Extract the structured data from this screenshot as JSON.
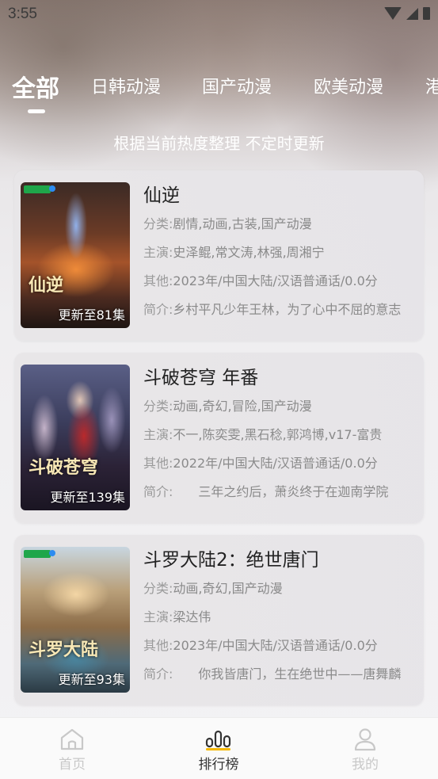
{
  "status_bar": {
    "time": "3:55"
  },
  "tabs": [
    "全部",
    "日韩动漫",
    "国产动漫",
    "欧美动漫",
    "港"
  ],
  "active_tab": 0,
  "subtitle": "根据当前热度整理 不定时更新",
  "labels": {
    "category": "分类:",
    "cast": "主演:",
    "other": "其他:",
    "intro": "简介:"
  },
  "items": [
    {
      "title": "仙逆",
      "episode": "更新至81集",
      "poster_text": "仙逆",
      "category": "剧情,动画,古装,国产动漫",
      "cast": "史泽鲲,常文涛,林强,周湘宁",
      "other": "2023年/中国大陆/汉语普通话/0.0分",
      "intro": "乡村平凡少年王林，为了心中不屈的意志"
    },
    {
      "title": "斗破苍穹 年番",
      "episode": "更新至139集",
      "poster_text": "斗破苍穹",
      "category": "动画,奇幻,冒险,国产动漫",
      "cast": "不一,陈奕雯,黑石稔,郭鸿博,v17-富贵",
      "other": "2022年/中国大陆/汉语普通话/0.0分",
      "intro": "　　三年之约后，萧炎终于在迦南学院"
    },
    {
      "title": "斗罗大陆2：绝世唐门",
      "episode": "更新至93集",
      "poster_text": "斗罗大陆",
      "category": "动画,奇幻,国产动漫",
      "cast": "梁达伟",
      "other": "2023年/中国大陆/汉语普通话/0.0分",
      "intro": "　　你我皆唐门，生在绝世中——唐舞麟"
    }
  ],
  "bottom_nav": [
    {
      "label": "首页",
      "icon": "home-icon"
    },
    {
      "label": "排行榜",
      "icon": "ranking-icon"
    },
    {
      "label": "我的",
      "icon": "profile-icon"
    }
  ],
  "colors": {
    "accent": "#f5b800",
    "active_text": "#333333",
    "inactive_text": "#c8c8c8"
  }
}
